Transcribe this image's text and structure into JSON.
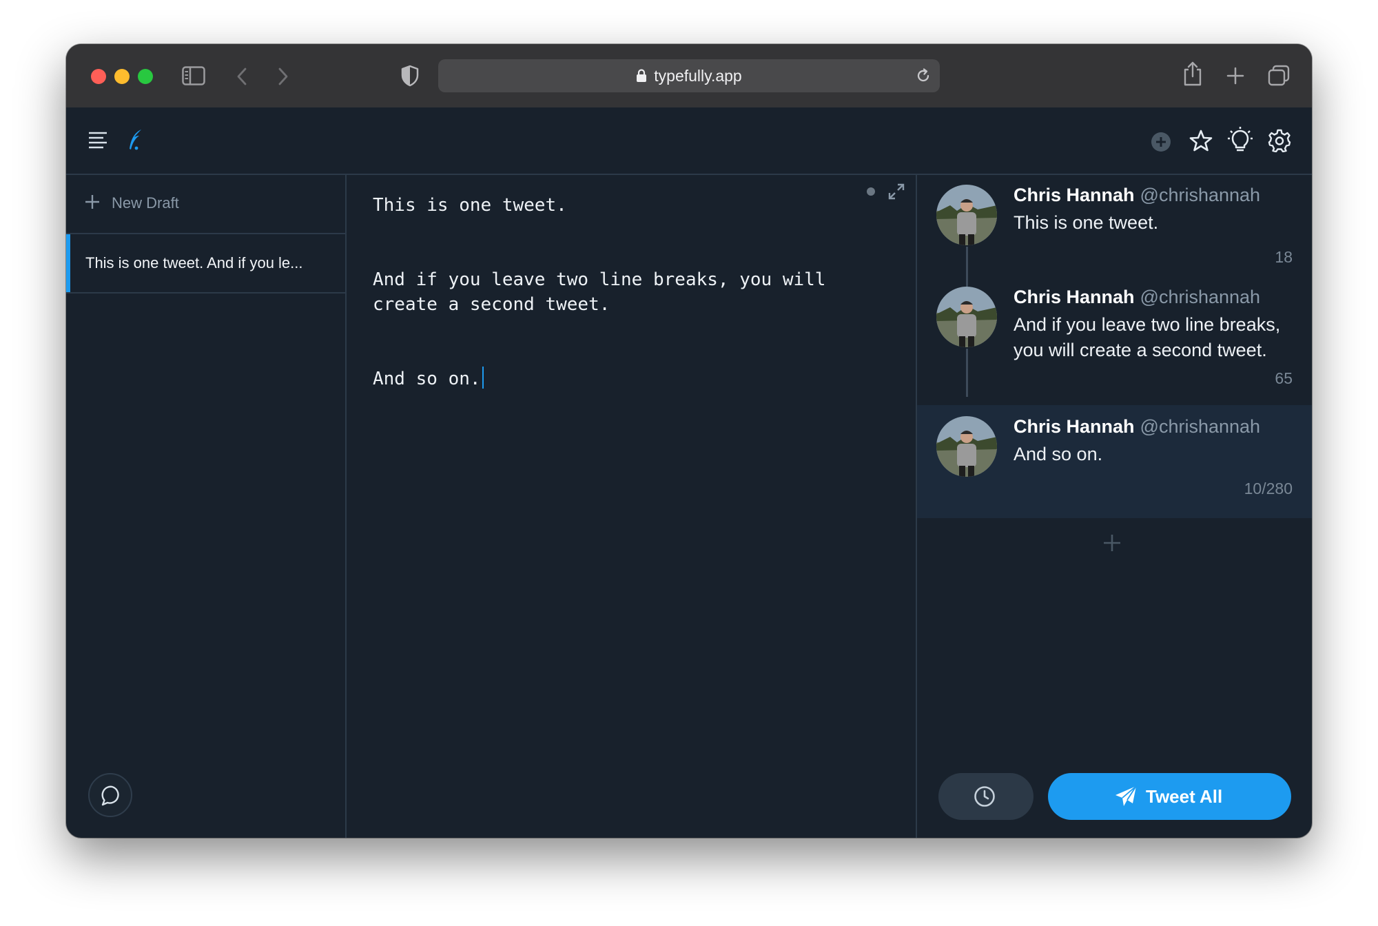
{
  "browser": {
    "url": "typefully.app"
  },
  "sidebar": {
    "new_draft_label": "New Draft",
    "drafts": [
      {
        "preview": "This is one tweet. And if you le..."
      }
    ]
  },
  "editor": {
    "paragraphs": [
      "This is one tweet.",
      "And if you leave two line breaks, you will create a second tweet.",
      "And so on."
    ]
  },
  "preview": {
    "tweets": [
      {
        "name": "Chris Hannah",
        "handle": "@chrishannah",
        "text": "This is one tweet.",
        "count": "18"
      },
      {
        "name": "Chris Hannah",
        "handle": "@chrishannah",
        "text": "And if you leave two line breaks, you will create a second tweet.",
        "count": "65"
      },
      {
        "name": "Chris Hannah",
        "handle": "@chrishannah",
        "text": "And so on.",
        "count": "10/280"
      }
    ],
    "tweet_all_label": "Tweet All"
  },
  "colors": {
    "accent": "#1d9bf0",
    "background": "#18212c",
    "active_tweet": "#1c2a3b"
  },
  "icons": [
    "sidebar-icon",
    "back-icon",
    "forward-icon",
    "shield-icon",
    "lock-icon",
    "reload-icon",
    "share-icon",
    "new-tab-icon",
    "tabs-icon",
    "menu-icon",
    "feather-logo-icon",
    "plus-circle-icon",
    "star-icon",
    "lightbulb-icon",
    "gear-icon",
    "plus-icon",
    "chat-icon",
    "expand-icon",
    "clock-icon",
    "send-icon"
  ]
}
